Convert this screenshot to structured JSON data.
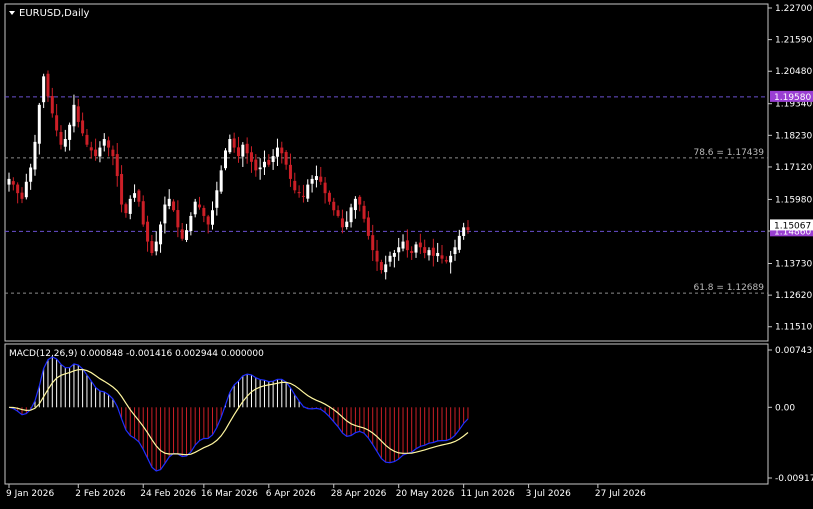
{
  "window": {
    "symbol_label": "EURUSD,Daily",
    "indicator_label": "MACD(12,26,9) 0.000848 -0.001416 0.002944 0.000000"
  },
  "colors": {
    "background": "#000000",
    "frame": "#c8c8c8",
    "bull": "#ffffff",
    "bear": "#cc1f27",
    "macd_line": "#1f2fff",
    "signal_line": "#fff7a0",
    "hline": "#6a4fd0",
    "fib_line": "#8c8c8c",
    "price_tag_bg": "#9a3fd3",
    "price_tag_text": "#ffffff",
    "current_tag_bg": "#ffffff",
    "current_tag_text": "#000000"
  },
  "chart_data": [
    {
      "type": "candlestick",
      "title": "EURUSD,Daily",
      "ylim": [
        1.1115,
        1.227
      ],
      "y_ticks": [
        "1.22700",
        "1.21590",
        "1.20480",
        "1.19340",
        "1.18230",
        "1.17120",
        "1.15980",
        "1.14870",
        "1.13730",
        "1.12620",
        "1.11510"
      ],
      "x_ticks": [
        "9 Jan 2026",
        "2 Feb 2026",
        "24 Feb 2026",
        "16 Mar 2026",
        "6 Apr 2026",
        "28 Apr 2026",
        "20 May 2026",
        "11 Jun 2026",
        "3 Jul 2026",
        "27 Jul 2026"
      ],
      "x_tick_index": [
        0,
        16,
        31,
        45,
        60,
        75,
        90,
        105,
        120,
        136
      ],
      "close_path": [
        1.167,
        1.165,
        1.162,
        1.16,
        1.166,
        1.171,
        1.18,
        1.193,
        1.203,
        1.196,
        1.19,
        1.184,
        1.179,
        1.181,
        1.186,
        1.193,
        1.187,
        1.183,
        1.179,
        1.177,
        1.175,
        1.178,
        1.181,
        1.178,
        1.175,
        1.168,
        1.158,
        1.155,
        1.16,
        1.162,
        1.159,
        1.151,
        1.145,
        1.141,
        1.145,
        1.151,
        1.158,
        1.16,
        1.156,
        1.15,
        1.146,
        1.149,
        1.154,
        1.159,
        1.157,
        1.154,
        1.151,
        1.156,
        1.163,
        1.17,
        1.177,
        1.181,
        1.178,
        1.175,
        1.179,
        1.176,
        1.173,
        1.17,
        1.171,
        1.173,
        1.172,
        1.175,
        1.178,
        1.176,
        1.172,
        1.167,
        1.163,
        1.162,
        1.161,
        1.165,
        1.167,
        1.168,
        1.166,
        1.162,
        1.159,
        1.156,
        1.154,
        1.15,
        1.152,
        1.157,
        1.16,
        1.158,
        1.153,
        1.147,
        1.142,
        1.138,
        1.135,
        1.137,
        1.14,
        1.141,
        1.143,
        1.145,
        1.142,
        1.141,
        1.144,
        1.143,
        1.141,
        1.142,
        1.14,
        1.141,
        1.139,
        1.138,
        1.14,
        1.143,
        1.147,
        1.15,
        1.149
      ],
      "current_price_tag": "1.15067",
      "price_levels": [
        {
          "price": 1.1958,
          "label": "1.19580",
          "style": "line"
        },
        {
          "price": 1.1486,
          "label": "1.14860",
          "style": "line"
        }
      ],
      "fib_levels": [
        {
          "price": 1.17439,
          "label": "78.6 = 1.17439"
        },
        {
          "price": 1.12689,
          "label": "61.8 = 1.12689"
        }
      ]
    },
    {
      "type": "macd",
      "params": [
        12,
        26,
        9
      ],
      "ylim": [
        -0.009176,
        0.007436
      ],
      "y_ticks": [
        "0.007436",
        "0.00",
        "-0.009176"
      ],
      "values_readout": "0.000848 -0.001416 0.002944 0.000000"
    }
  ]
}
